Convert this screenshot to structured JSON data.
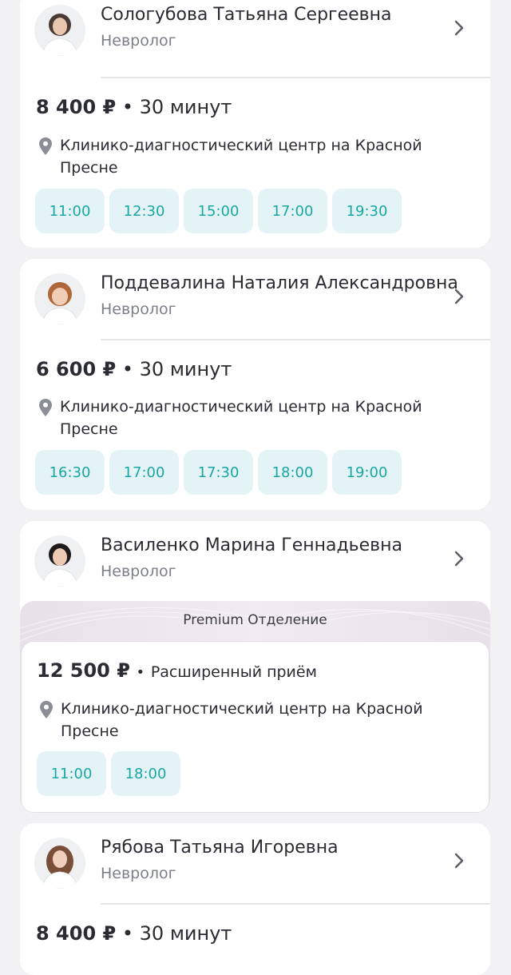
{
  "doctors": [
    {
      "name": "Сологубова Татьяна Сергеевна",
      "specialty": "Невролог",
      "price": "8 400 ₽",
      "separator": "•",
      "duration": "30 минут",
      "address": "Клинико-диагностический центр на Красной Пресне",
      "slots": [
        "11:00",
        "12:30",
        "15:00",
        "17:00",
        "19:30"
      ]
    },
    {
      "name": "Поддевалина Наталия Александровна",
      "specialty": "Невролог",
      "price": "6 600 ₽",
      "separator": "•",
      "duration": "30 минут",
      "address": "Клинико-диагностический центр на Красной Пресне",
      "slots": [
        "16:30",
        "17:00",
        "17:30",
        "18:00",
        "19:00"
      ]
    },
    {
      "name": "Василенко Марина Геннадьевна",
      "specialty": "Невролог",
      "premium_label": "Premium Отделение",
      "price": "12 500 ₽",
      "separator": "•",
      "duration": "Расширенный приём",
      "address": "Клинико-диагностический центр на Красной Пресне",
      "slots": [
        "11:00",
        "18:00"
      ]
    },
    {
      "name": "Рябова Татьяна Игоревна",
      "specialty": "Невролог",
      "price": "8 400 ₽",
      "separator": "•",
      "duration": "30 минут"
    }
  ],
  "icons": {
    "chevron": "chevron-right-icon",
    "pin": "location-pin-icon",
    "avatar": "doctor-photo"
  },
  "colors": {
    "accent": "#1aa7a4",
    "slot_bg": "#e4f3f6",
    "premium_bg": "#ede6ee"
  }
}
